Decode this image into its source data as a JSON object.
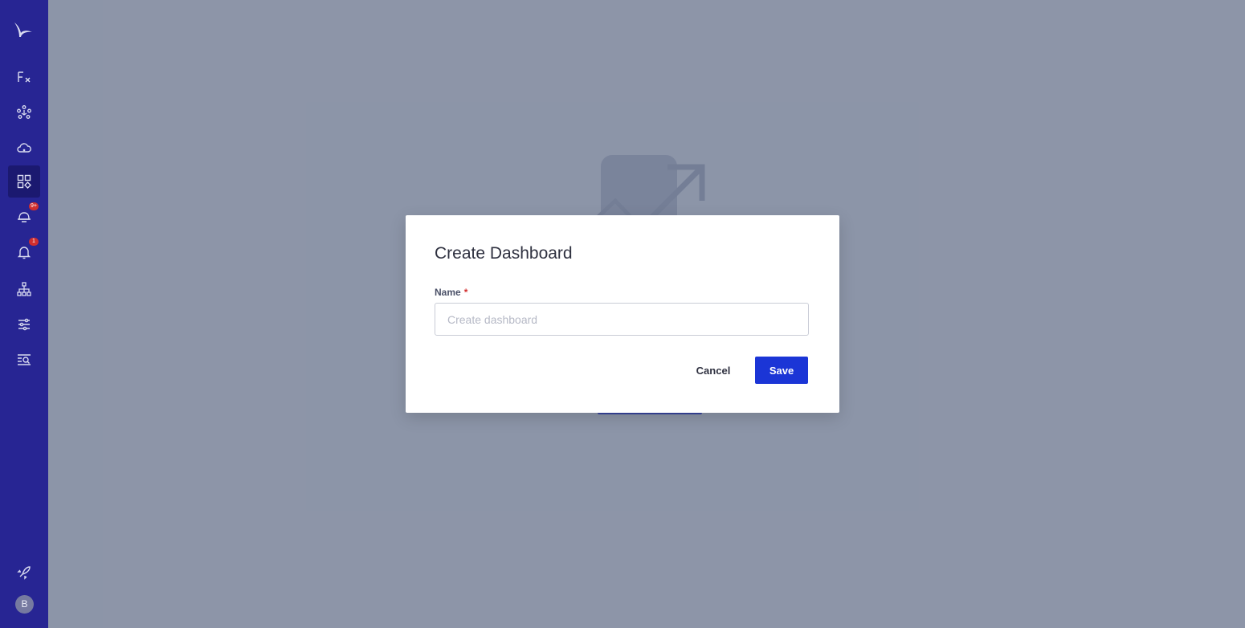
{
  "colors": {
    "sidebar_bg": "#272593",
    "sidebar_active": "#1b1970",
    "primary": "#1b35d6",
    "badge": "#d12e2e",
    "overlay": "rgba(66,80,110,0.58)"
  },
  "sidebar": {
    "items": [
      {
        "icon": "functions-icon"
      },
      {
        "icon": "integrations-icon"
      },
      {
        "icon": "cloud-icon"
      },
      {
        "icon": "dashboards-icon",
        "active": true
      },
      {
        "icon": "alerts-icon",
        "badge": "9+"
      },
      {
        "icon": "notifications-bell-icon",
        "badge": "1"
      },
      {
        "icon": "service-map-icon"
      },
      {
        "icon": "settings-sliders-icon"
      },
      {
        "icon": "logs-search-icon"
      }
    ],
    "footer": {
      "rocket_icon": "rocket-icon",
      "avatar_initial": "B"
    }
  },
  "modal": {
    "title": "Create Dashboard",
    "field": {
      "label": "Name",
      "required_mark": "*",
      "value": "",
      "placeholder": "Create dashboard"
    },
    "cancel_label": "Cancel",
    "save_label": "Save"
  }
}
